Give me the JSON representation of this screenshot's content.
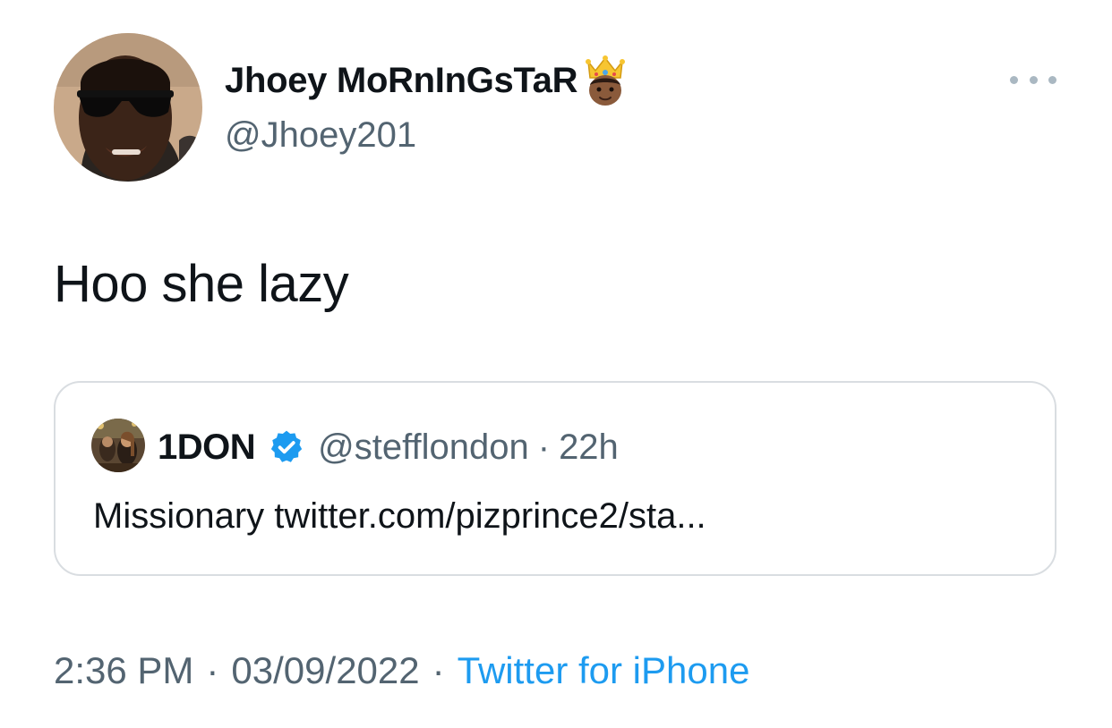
{
  "author": {
    "display_name": "Jhoey MoRnInGsTaR",
    "emoji": "crown-person-emoji",
    "handle": "@Jhoey201"
  },
  "more_icon": "more-horizontal-icon",
  "tweet": {
    "text": "Hoo she lazy"
  },
  "quoted_tweet": {
    "display_name": "1DON",
    "verified_icon": "verified-badge-icon",
    "handle": "@stefflondon",
    "separator": "·",
    "time": "22h",
    "text": "Missionary",
    "link": "twitter.com/pizprince2/sta..."
  },
  "meta": {
    "time": "2:36 PM",
    "separator": "·",
    "date": "03/09/2022",
    "separator2": "·",
    "source": "Twitter for iPhone"
  },
  "colors": {
    "text_primary": "#0f1419",
    "text_secondary": "#536471",
    "link": "#1d9bf0",
    "verified": "#1d9bf0",
    "border": "#d9dde1",
    "more_dots": "#aab8c2"
  }
}
